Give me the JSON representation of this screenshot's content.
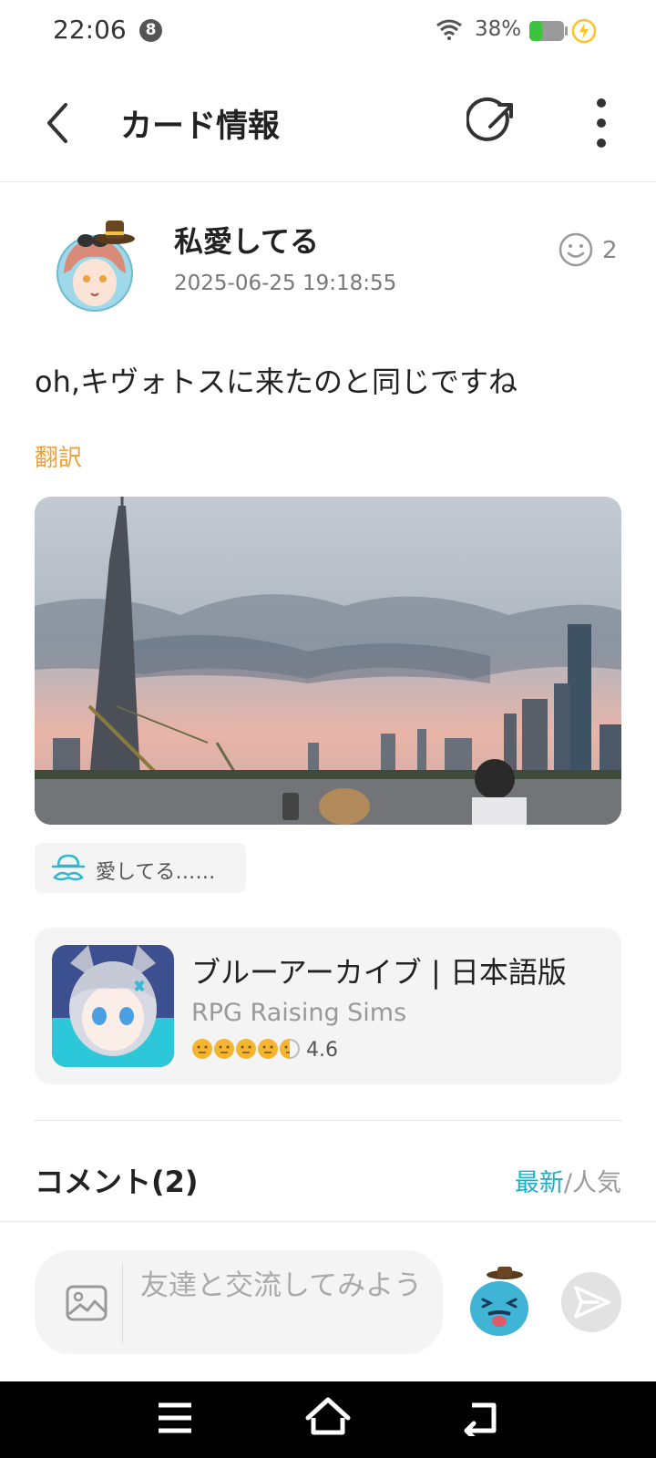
{
  "status_bar": {
    "time": "22:06",
    "notification_count": "8",
    "battery_percent": "38%",
    "battery_level": 0.38,
    "battery_color": "#3cc53c",
    "charge_color": "#ffc21f"
  },
  "header": {
    "title": "カード情報",
    "back_icon": "chevron-left-icon",
    "share_icon": "share-icon",
    "more_icon": "more-vertical-icon"
  },
  "post": {
    "author": "私愛してる",
    "timestamp": "2025-06-25 19:18:55",
    "reaction_count": "2",
    "text": "oh,キヴォトスに来たのと同じですね",
    "translate_label": "翻訳",
    "translate_color": "#f0a030",
    "tag_label": "愛してる……",
    "tag_icon": "mustache-hat-icon"
  },
  "game": {
    "title": "ブルーアーカイブ | 日本語版",
    "genre": "RPG Raising Sims",
    "rating": "4.6",
    "rating_icon": "face-rating-icon"
  },
  "comments": {
    "title": "コメント(2)",
    "sort_newest": "最新",
    "sort_separator": "/",
    "sort_popular": "人気",
    "accent_color": "#1ab0c8"
  },
  "composer": {
    "placeholder": "友達と交流してみよう",
    "image_icon": "image-icon",
    "mascot_icon": "mascot-emoji-icon",
    "send_icon": "send-icon"
  },
  "nav_bar": {
    "menu_icon": "menu-icon",
    "home_icon": "home-icon",
    "back_icon": "back-icon"
  }
}
